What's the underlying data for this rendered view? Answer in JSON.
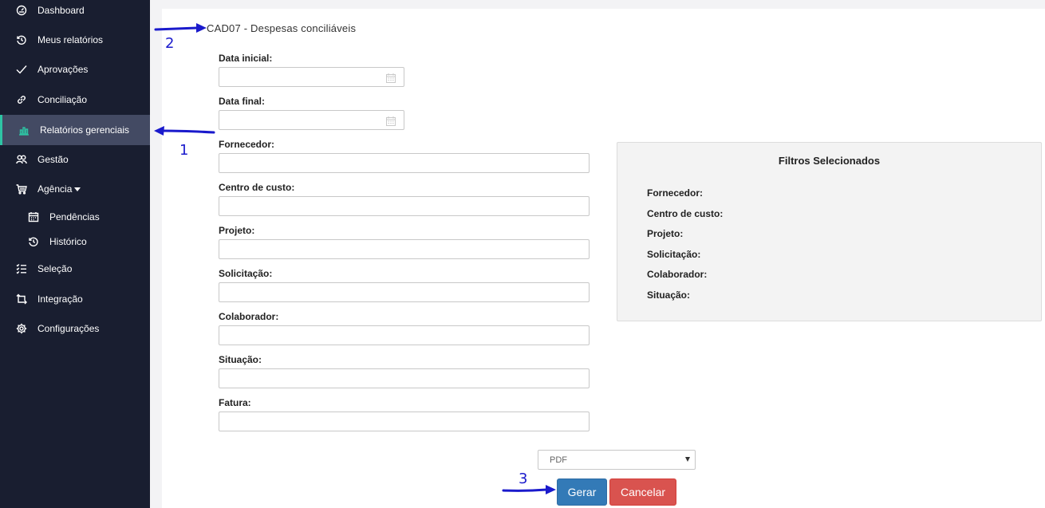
{
  "sidebar": {
    "items": [
      {
        "label": "Dashboard",
        "icon": "dashboard-icon"
      },
      {
        "label": "Meus relatórios",
        "icon": "history-icon"
      },
      {
        "label": "Aprovações",
        "icon": "check-icon"
      },
      {
        "label": "Conciliação",
        "icon": "link-icon"
      },
      {
        "label": "Relatórios gerenciais",
        "icon": "bar-chart-icon",
        "active": true
      },
      {
        "label": "Gestão",
        "icon": "users-icon"
      },
      {
        "label": "Agência",
        "icon": "cart-icon"
      },
      {
        "label": "Pendências",
        "icon": "calendar-icon"
      },
      {
        "label": "Histórico",
        "icon": "history-icon"
      },
      {
        "label": "Seleção",
        "icon": "checklist-icon"
      },
      {
        "label": "Integração",
        "icon": "integration-icon"
      },
      {
        "label": "Configurações",
        "icon": "gear-icon"
      }
    ]
  },
  "page": {
    "title": "CAD07 - Despesas conciliáveis"
  },
  "form": {
    "fields": [
      {
        "label": "Data inicial:",
        "value": ""
      },
      {
        "label": "Data final:",
        "value": ""
      },
      {
        "label": "Fornecedor:",
        "value": ""
      },
      {
        "label": "Centro de custo:",
        "value": ""
      },
      {
        "label": "Projeto:",
        "value": ""
      },
      {
        "label": "Solicitação:",
        "value": ""
      },
      {
        "label": "Colaborador:",
        "value": ""
      },
      {
        "label": "Situação:",
        "value": ""
      },
      {
        "label": "Fatura:",
        "value": ""
      }
    ]
  },
  "filters": {
    "title": "Filtros Selecionados",
    "rows": [
      "Fornecedor:",
      "Centro de custo:",
      "Projeto:",
      "Solicitação:",
      "Colaborador:",
      "Situação:"
    ]
  },
  "actions": {
    "format_value": "PDF",
    "generate_label": "Gerar",
    "cancel_label": "Cancelar"
  },
  "annotations": [
    "1",
    "2",
    "3"
  ],
  "colors": {
    "sidebar_bg": "#191e30",
    "active_bg": "#434a63",
    "active_accent": "#2ec4a4",
    "primary": "#337ab7",
    "danger": "#d9534f",
    "annotation": "#1a1acc"
  }
}
